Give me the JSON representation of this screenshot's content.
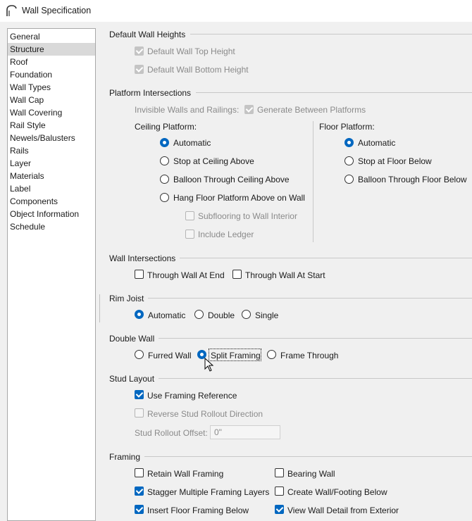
{
  "window": {
    "title": "Wall Specification",
    "app_icon": "arch-roof-icon"
  },
  "categories": {
    "items": [
      "General",
      "Structure",
      "Roof",
      "Foundation",
      "Wall Types",
      "Wall Cap",
      "Wall Covering",
      "Rail Style",
      "Newels/Balusters",
      "Rails",
      "Layer",
      "Materials",
      "Label",
      "Components",
      "Object Information",
      "Schedule"
    ],
    "selected": "Structure"
  },
  "default_wall_heights": {
    "header": "Default Wall Heights",
    "top_label": "Default Wall Top Height",
    "top_checked": true,
    "bottom_label": "Default Wall Bottom Height",
    "bottom_checked": true
  },
  "platform_intersections": {
    "header": "Platform Intersections",
    "invisible_label": "Invisible Walls and Railings:",
    "generate_label": "Generate Between Platforms",
    "generate_checked": true,
    "ceiling": {
      "title": "Ceiling Platform:",
      "options": [
        "Automatic",
        "Stop at Ceiling Above",
        "Balloon Through Ceiling Above",
        "Hang Floor Platform Above on Wall"
      ],
      "selected": "Automatic",
      "subflooring_label": "Subflooring to Wall Interior",
      "subflooring_checked": false,
      "ledger_label": "Include Ledger",
      "ledger_checked": false
    },
    "floor": {
      "title": "Floor Platform:",
      "options": [
        "Automatic",
        "Stop at Floor Below",
        "Balloon Through Floor Below"
      ],
      "selected": "Automatic"
    }
  },
  "wall_intersections": {
    "header": "Wall Intersections",
    "through_end_label": "Through Wall At End",
    "through_end_checked": false,
    "through_start_label": "Through Wall At Start",
    "through_start_checked": false
  },
  "rim_joist": {
    "header": "Rim Joist",
    "options": [
      "Automatic",
      "Double",
      "Single"
    ],
    "selected": "Automatic"
  },
  "double_wall": {
    "header": "Double Wall",
    "options": [
      "Furred Wall",
      "Split Framing",
      "Frame Through"
    ],
    "selected": "Split Framing"
  },
  "stud_layout": {
    "header": "Stud Layout",
    "use_framing_label": "Use Framing Reference",
    "use_framing_checked": true,
    "reverse_label": "Reverse Stud Rollout Direction",
    "reverse_checked": false,
    "offset_label": "Stud Rollout Offset:",
    "offset_value": "0\""
  },
  "framing": {
    "header": "Framing",
    "retain_label": "Retain Wall Framing",
    "retain_checked": false,
    "bearing_label": "Bearing Wall",
    "bearing_checked": false,
    "stagger_label": "Stagger Multiple Framing Layers",
    "stagger_checked": true,
    "create_footing_label": "Create Wall/Footing Below",
    "create_footing_checked": false,
    "insert_floor_label": "Insert Floor Framing Below",
    "insert_floor_checked": true,
    "view_detail_label": "View Wall Detail from Exterior",
    "view_detail_checked": true
  },
  "colors": {
    "accent": "#0067c0",
    "dialog_bg": "#f0f0f0",
    "selection": "#d9d9d9"
  }
}
